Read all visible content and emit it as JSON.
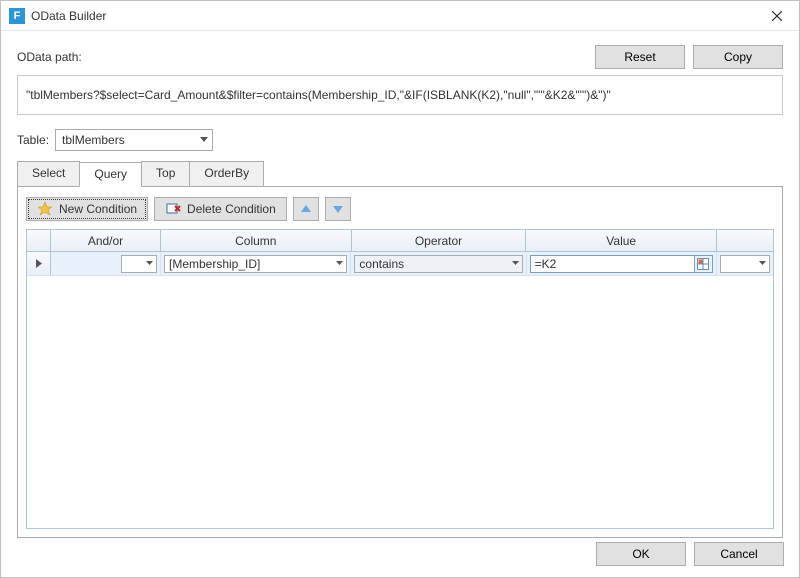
{
  "window": {
    "title": "OData Builder",
    "app_icon_letter": "F"
  },
  "path": {
    "label": "OData path:",
    "reset_btn": "Reset",
    "copy_btn": "Copy",
    "value": "\"tblMembers?$select=Card_Amount&$filter=contains(Membership_ID,\"&IF(ISBLANK(K2),\"null\",\"'\"&K2&\"'\")&\")\""
  },
  "table": {
    "label": "Table:",
    "value": "tblMembers"
  },
  "tabs": {
    "select": "Select",
    "query": "Query",
    "top": "Top",
    "orderby": "OrderBy",
    "active": "query"
  },
  "toolbar": {
    "new_condition": "New Condition",
    "delete_condition": "Delete Condition"
  },
  "grid": {
    "headers": {
      "andor": "And/or",
      "column": "Column",
      "operator": "Operator",
      "value": "Value"
    },
    "rows": [
      {
        "andor": "",
        "column": "[Membership_ID]",
        "operator": "contains",
        "value": "=K2",
        "last": ""
      }
    ]
  },
  "footer": {
    "ok": "OK",
    "cancel": "Cancel"
  }
}
